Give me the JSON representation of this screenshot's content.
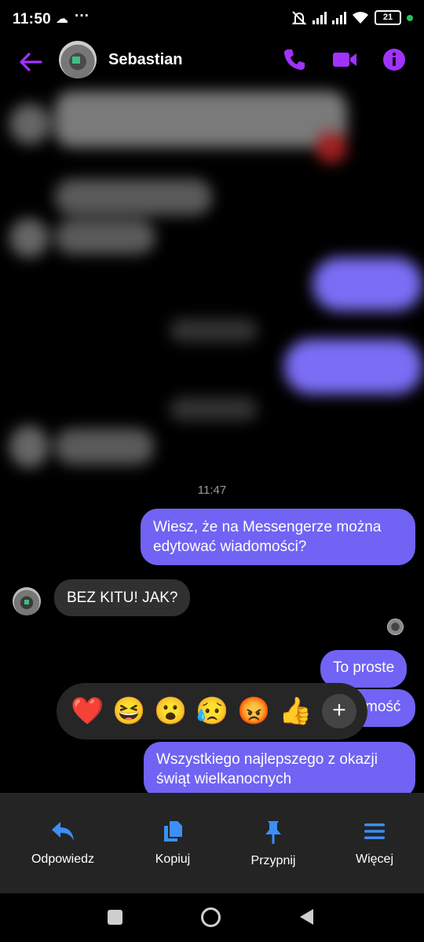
{
  "status_bar": {
    "time": "11:50",
    "more": "···",
    "battery": "21"
  },
  "header": {
    "contact_name": "Sebastian"
  },
  "chat": {
    "timestamp": "11:47",
    "messages": [
      {
        "direction": "outgoing",
        "text": "Wiesz, że na Messengerze można edytować wiadomości?"
      },
      {
        "direction": "incoming",
        "text": "BEZ KITU! JAK?"
      },
      {
        "direction": "outgoing",
        "text": "To proste"
      },
      {
        "direction": "outgoing",
        "text": "mość"
      },
      {
        "direction": "outgoing",
        "text": "Wszystkiego najlepszego z okazji świąt wielkanocnych"
      }
    ]
  },
  "reactions": [
    "❤️",
    "😆",
    "😮",
    "😥",
    "😡",
    "👍"
  ],
  "reaction_more": "+",
  "actions": [
    {
      "label": "Odpowiedz",
      "icon": "reply-icon"
    },
    {
      "label": "Kopiuj",
      "icon": "copy-icon"
    },
    {
      "label": "Przypnij",
      "icon": "pin-icon"
    },
    {
      "label": "Więcej",
      "icon": "menu-icon"
    }
  ],
  "colors": {
    "accent": "#a033ff",
    "outgoing_bubble": "#7163f3",
    "incoming_bubble": "#303030",
    "action_icon": "#3d8ef5"
  }
}
